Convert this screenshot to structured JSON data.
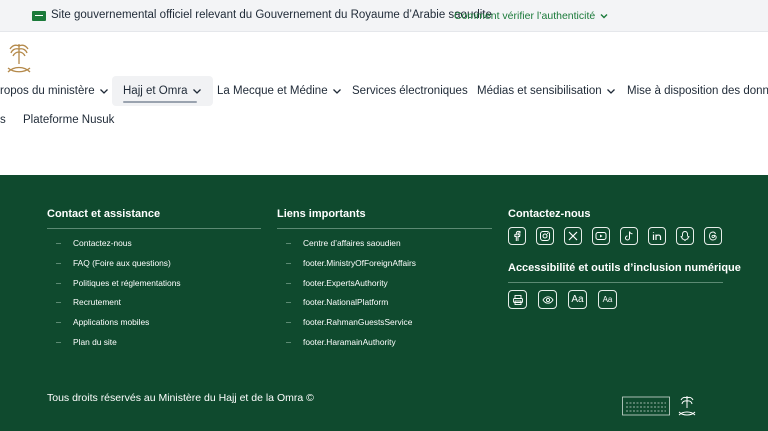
{
  "banner": {
    "text": "Site gouvernemental officiel relevant du Gouvernement du Royaume d’Arabie saoudite",
    "verify": "Comment vérifier l’authenticité",
    "flag_color": "#1b7a3a"
  },
  "nav": {
    "items": [
      {
        "label": "ropos du ministère",
        "dropdown": true
      },
      {
        "label": "Hajj et Omra",
        "dropdown": true,
        "active": true
      },
      {
        "label": "La Mecque et Médine",
        "dropdown": true
      },
      {
        "label": "Services électroniques",
        "dropdown": false
      },
      {
        "label": "Médias et sensibilisation",
        "dropdown": true
      },
      {
        "label": "Mise à disposition des données",
        "dropdown": false
      }
    ],
    "row2": {
      "partial": "s",
      "nusuk": "Plateforme Nusuk"
    }
  },
  "footer": {
    "bg_color": "#0f4a2e",
    "contact": {
      "title": "Contact et assistance",
      "links": [
        "Contactez-nous",
        "FAQ (Foire aux questions)",
        "Politiques et réglementations",
        "Recrutement",
        "Applications mobiles",
        "Plan du site"
      ]
    },
    "important": {
      "title": "Liens importants",
      "links": [
        "Centre d’affaires saoudien",
        "footer.MinistryOfForeignAffairs",
        "footer.ExpertsAuthority",
        "footer.NationalPlatform",
        "footer.RahmanGuestsService",
        "footer.HaramainAuthority"
      ]
    },
    "social": {
      "title": "Contactez-nous",
      "icons": [
        "facebook-icon",
        "instagram-icon",
        "x-icon",
        "youtube-icon",
        "tiktok-icon",
        "linkedin-icon",
        "snapchat-icon",
        "threads-icon"
      ]
    },
    "accessibility": {
      "title": "Accessibilité et outils d’inclusion numérique",
      "tools": [
        {
          "icon": "print-icon",
          "label": ""
        },
        {
          "icon": "eye-icon",
          "label": ""
        },
        {
          "icon": "font-increase-icon",
          "label": "Aa"
        },
        {
          "icon": "font-decrease-icon",
          "label": "Aa"
        }
      ]
    },
    "copyright": "Tous droits réservés au Ministère du Hajj et de la Omra ©"
  }
}
